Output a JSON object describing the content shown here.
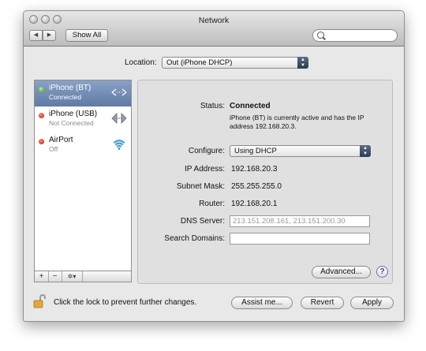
{
  "window": {
    "title": "Network"
  },
  "toolbar": {
    "back_label": "◀",
    "forward_label": "▶",
    "show_all_label": "Show All",
    "search_placeholder": ""
  },
  "location": {
    "label": "Location:",
    "value": "Out (iPhone DHCP)"
  },
  "sidebar": {
    "items": [
      {
        "name": "iPhone (BT)",
        "status": "Connected",
        "state": "green",
        "icon": "bluetooth-arrows-icon",
        "selected": true
      },
      {
        "name": "iPhone (USB)",
        "status": "Not Connected",
        "state": "red",
        "icon": "ethernet-arrows-icon",
        "selected": false
      },
      {
        "name": "AirPort",
        "status": "Off",
        "state": "red",
        "icon": "wifi-icon",
        "selected": false
      }
    ],
    "add_label": "+",
    "remove_label": "−",
    "action_label": "✲▾"
  },
  "detail": {
    "status_label": "Status:",
    "status_value": "Connected",
    "status_desc_line1": "iPhone (BT) is currently active and has the IP",
    "status_desc_line2": "address 192.168.20.3.",
    "configure_label": "Configure:",
    "configure_value": "Using DHCP",
    "ip_label": "IP Address:",
    "ip_value": "192.168.20.3",
    "subnet_label": "Subnet Mask:",
    "subnet_value": "255.255.255.0",
    "router_label": "Router:",
    "router_value": "192.168.20.1",
    "dns_label": "DNS Server:",
    "dns_placeholder": "213.151.208.161, 213.151.200.30",
    "search_domains_label": "Search Domains:",
    "search_domains_value": "",
    "advanced_label": "Advanced...",
    "help_label": "?"
  },
  "footer": {
    "lock_text": "Click the lock to prevent further changes.",
    "assist_label": "Assist me...",
    "revert_label": "Revert",
    "apply_label": "Apply"
  },
  "colors": {
    "selection": "#6f89b3",
    "connected": "#3f9a16",
    "disconnected": "#c4160a",
    "help": "#4b3a96"
  }
}
